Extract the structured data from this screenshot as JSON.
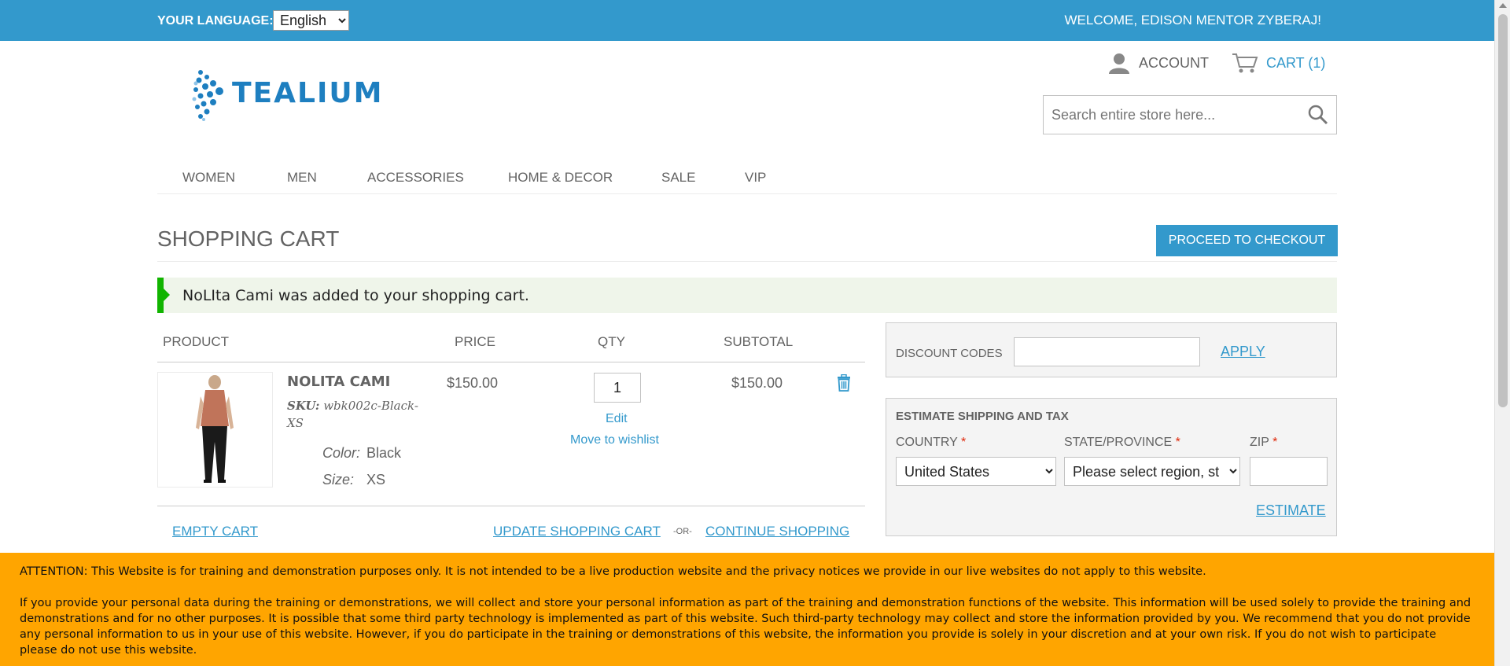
{
  "header": {
    "language_label": "YOUR LANGUAGE:",
    "language_value": "English",
    "welcome": "WELCOME, EDISON MENTOR ZYBERAJ!",
    "account_label": "ACCOUNT",
    "cart_label": "CART (1)",
    "search_placeholder": "Search entire store here...",
    "logo_text": "TEALIUM",
    "brand_color": "#3399cc"
  },
  "nav": {
    "items": [
      "WOMEN",
      "MEN",
      "ACCESSORIES",
      "HOME & DECOR",
      "SALE",
      "VIP"
    ]
  },
  "cart": {
    "title": "SHOPPING CART",
    "checkout_label": "PROCEED TO CHECKOUT",
    "success_message": "NoLIta Cami was added to your shopping cart.",
    "columns": [
      "PRODUCT",
      "PRICE",
      "QTY",
      "SUBTOTAL"
    ],
    "item": {
      "name": "NOLITA CAMI",
      "sku_label": "SKU:",
      "sku_value": "wbk002c-Black-XS",
      "color_label": "Color:",
      "color_value": "Black",
      "size_label": "Size:",
      "size_value": "XS",
      "price": "$150.00",
      "qty": "1",
      "edit_label": "Edit",
      "wishlist_label": "Move to wishlist",
      "subtotal": "$150.00"
    },
    "empty_label": "EMPTY CART",
    "update_label": "UPDATE SHOPPING CART",
    "or_label": "-OR-",
    "continue_label": "CONTINUE SHOPPING"
  },
  "discount": {
    "label": "DISCOUNT CODES",
    "apply_label": "APPLY"
  },
  "shipping": {
    "title": "ESTIMATE SHIPPING AND TAX",
    "country_label": "COUNTRY",
    "state_label": "STATE/PROVINCE",
    "zip_label": "ZIP",
    "required_mark": "*",
    "country_value": "United States",
    "state_value": "Please select region, st",
    "estimate_label": "ESTIMATE"
  },
  "notice": {
    "paragraph1": "ATTENTION: This Website is for training and demonstration purposes only. It is not intended to be a live production website and the privacy notices we provide in our live websites do not apply to this website.",
    "paragraph2": "If you provide your personal data during the training or demonstrations, we will collect and store your personal information as part of the training and demonstration functions of the website. This information will be used solely to provide the training and demonstrations and for no other purposes. It is possible that some third party technology is implemented as part of this website. Such third-party technology may collect and store the information provided by you. We recommend that you do not provide any personal information to us in your use of this website. However, if you do participate in the training or demonstrations of this website, the information you provide is solely in your discretion and at your own risk. If you do not wish to participate please do not use this website."
  }
}
